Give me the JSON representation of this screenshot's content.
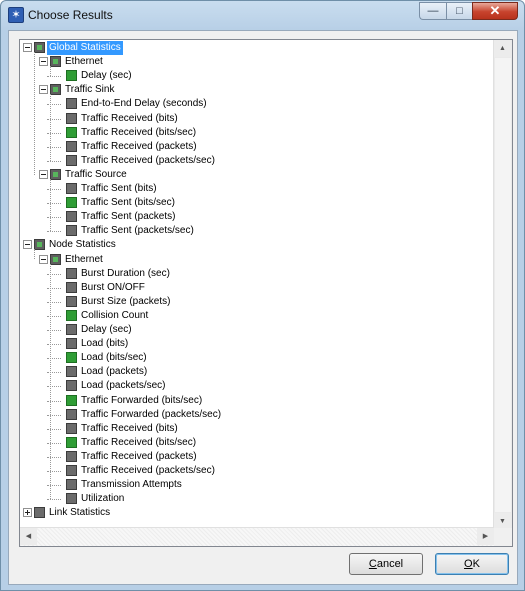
{
  "window": {
    "title": "Choose Results"
  },
  "caption_buttons": {
    "minimize": "—",
    "maximize": "□",
    "close": "✕"
  },
  "tree": {
    "rows": [
      {
        "label": "Global Statistics",
        "level": 0,
        "expander": "minus",
        "check": "mixed",
        "selected": true
      },
      {
        "label": "Ethernet",
        "level": 1,
        "expander": "minus",
        "check": "mixed"
      },
      {
        "label": "Delay (sec)",
        "level": 2,
        "check": "green"
      },
      {
        "label": "Traffic Sink",
        "level": 1,
        "expander": "minus",
        "check": "mixed"
      },
      {
        "label": "End-to-End Delay (seconds)",
        "level": 2,
        "check": "gray"
      },
      {
        "label": "Traffic Received (bits)",
        "level": 2,
        "check": "gray"
      },
      {
        "label": "Traffic Received (bits/sec)",
        "level": 2,
        "check": "green"
      },
      {
        "label": "Traffic Received (packets)",
        "level": 2,
        "check": "gray"
      },
      {
        "label": "Traffic Received (packets/sec)",
        "level": 2,
        "check": "gray"
      },
      {
        "label": "Traffic Source",
        "level": 1,
        "expander": "minus",
        "check": "mixed"
      },
      {
        "label": "Traffic Sent (bits)",
        "level": 2,
        "check": "gray"
      },
      {
        "label": "Traffic Sent (bits/sec)",
        "level": 2,
        "check": "green"
      },
      {
        "label": "Traffic Sent (packets)",
        "level": 2,
        "check": "gray"
      },
      {
        "label": "Traffic Sent (packets/sec)",
        "level": 2,
        "check": "gray"
      },
      {
        "label": "Node Statistics",
        "level": 0,
        "expander": "minus",
        "check": "mixed"
      },
      {
        "label": "Ethernet",
        "level": 1,
        "expander": "minus",
        "check": "mixed"
      },
      {
        "label": "Burst Duration (sec)",
        "level": 2,
        "check": "gray"
      },
      {
        "label": "Burst ON/OFF",
        "level": 2,
        "check": "gray"
      },
      {
        "label": "Burst Size (packets)",
        "level": 2,
        "check": "gray"
      },
      {
        "label": "Collision Count",
        "level": 2,
        "check": "green"
      },
      {
        "label": "Delay (sec)",
        "level": 2,
        "check": "gray"
      },
      {
        "label": "Load (bits)",
        "level": 2,
        "check": "gray"
      },
      {
        "label": "Load (bits/sec)",
        "level": 2,
        "check": "green"
      },
      {
        "label": "Load (packets)",
        "level": 2,
        "check": "gray"
      },
      {
        "label": "Load (packets/sec)",
        "level": 2,
        "check": "gray"
      },
      {
        "label": "Traffic Forwarded (bits/sec)",
        "level": 2,
        "check": "green"
      },
      {
        "label": "Traffic Forwarded (packets/sec)",
        "level": 2,
        "check": "gray"
      },
      {
        "label": "Traffic Received (bits)",
        "level": 2,
        "check": "gray"
      },
      {
        "label": "Traffic Received (bits/sec)",
        "level": 2,
        "check": "green"
      },
      {
        "label": "Traffic Received (packets)",
        "level": 2,
        "check": "gray"
      },
      {
        "label": "Traffic Received (packets/sec)",
        "level": 2,
        "check": "gray"
      },
      {
        "label": "Transmission Attempts",
        "level": 2,
        "check": "gray"
      },
      {
        "label": "Utilization",
        "level": 2,
        "check": "gray"
      },
      {
        "label": "Link Statistics",
        "level": 0,
        "expander": "plus",
        "check": "gray"
      }
    ]
  },
  "buttons": {
    "cancel": {
      "mnemonic": "C",
      "rest": "ancel"
    },
    "ok": {
      "mnemonic": "O",
      "rest": "K"
    }
  },
  "scroll": {
    "up": "▲",
    "down": "▼",
    "left": "◀",
    "right": "▶"
  },
  "icons": {
    "app": "app-icon"
  }
}
